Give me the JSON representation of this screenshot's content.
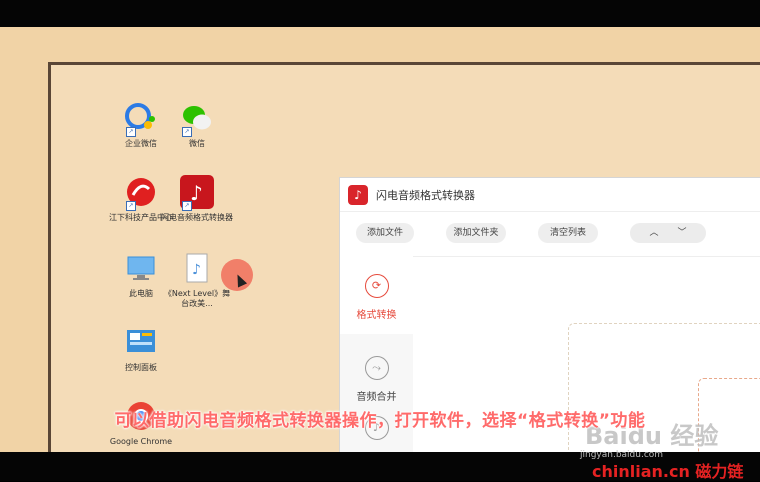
{
  "desktop": {
    "icons": [
      {
        "label": "企业微信",
        "icon": "wecom-icon",
        "color": "#2c7be5"
      },
      {
        "label": "微信",
        "icon": "wechat-icon",
        "color": "#2dc100"
      },
      {
        "label": "江下科技产品中心",
        "icon": "product-center-icon",
        "color": "#e02020"
      },
      {
        "label": "闪电音频格式转换器",
        "icon": "audio-converter-icon",
        "color": "#c8161d"
      },
      {
        "label": "此电脑",
        "icon": "computer-icon",
        "color": "#3a8fd8"
      },
      {
        "label": "《Next Level》舞台改美...",
        "icon": "audio-file-icon",
        "color": "#4a90d9"
      },
      {
        "label": "控制面板",
        "icon": "control-panel-icon",
        "color": "#3a8fd8"
      },
      {
        "label": "Google Chrome",
        "icon": "chrome-icon",
        "color": "#ea4335"
      }
    ]
  },
  "app": {
    "title": "闪电音频格式转换器",
    "toolbar": {
      "add_file": "添加文件",
      "add_folder": "添加文件夹",
      "clear_list": "清空列表",
      "up": "︿",
      "down": "﹀"
    },
    "sidebar": [
      {
        "label": "格式转换",
        "active": true
      },
      {
        "label": "音频合并",
        "active": false
      }
    ],
    "accent": "#e64a3c"
  },
  "subtitle": "可以借助闪电音频格式转换器操作，打开软件，选择“格式转换”功能",
  "watermark": {
    "text": "Baidu 经验",
    "url": "jingyan.baidu.com",
    "brand": "chinlian.cn 磁力链"
  }
}
